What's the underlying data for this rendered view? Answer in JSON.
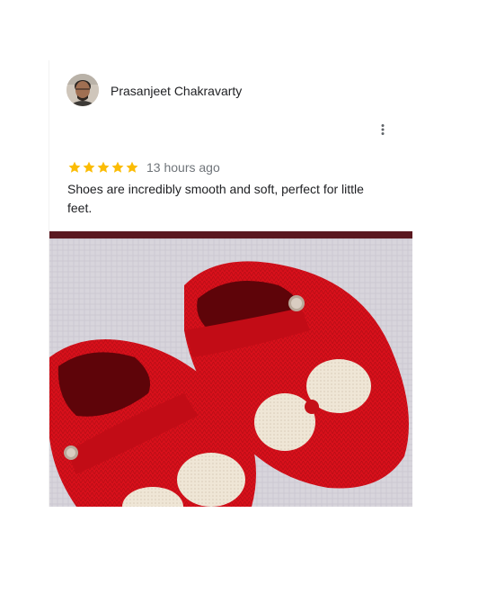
{
  "review": {
    "reviewer_name": "Prasanjeet Chakravarty",
    "rating": 5,
    "rating_max": 5,
    "time": "13 hours ago",
    "text": "Shoes are incredibly smooth and soft, perfect for little feet."
  },
  "icons": {
    "more": "more-vert-icon",
    "star": "star-icon"
  },
  "colors": {
    "star": "#fbbc04",
    "text": "#202124",
    "secondary_text": "#70757a",
    "shoe_red": "#d6101a",
    "bow_cream": "#ede4d3"
  }
}
